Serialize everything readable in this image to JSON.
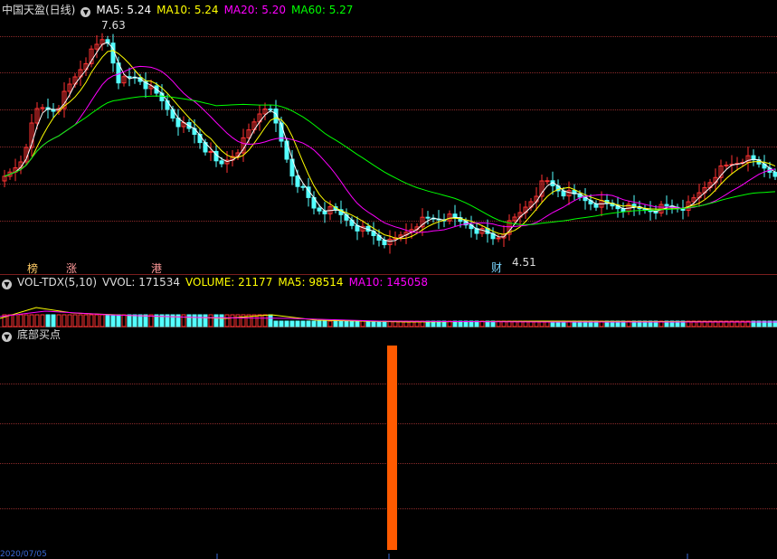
{
  "price_panel": {
    "title": "中国天盈(日线)",
    "ma5_label": "MA5: 5.24",
    "ma10_label": "MA10: 5.24",
    "ma20_label": "MA20: 5.20",
    "ma60_label": "MA60: 5.27",
    "high_label": "7.63",
    "low_label": "4.51",
    "markers": [
      "榜",
      "涨",
      "港",
      "财"
    ]
  },
  "volume_panel": {
    "indicator": "VOL-TDX(5,10)",
    "vvol_label": "VVOL: 171534",
    "volume_label": "VOLUME: 21177",
    "ma5_label": "MA5: 98514",
    "ma10_label": "MA10: 145058"
  },
  "indicator_panel": {
    "title": "底部买点"
  },
  "axis": {
    "date_label": "2020/07/05"
  },
  "colors": {
    "up": "#ff3232",
    "down": "#54ffff",
    "ma5": "#ffffff",
    "ma10": "#ffff00",
    "ma20": "#ff00ff",
    "ma60": "#00ff00",
    "signal": "#ff5a00",
    "grid": "#8a2a2a"
  }
}
